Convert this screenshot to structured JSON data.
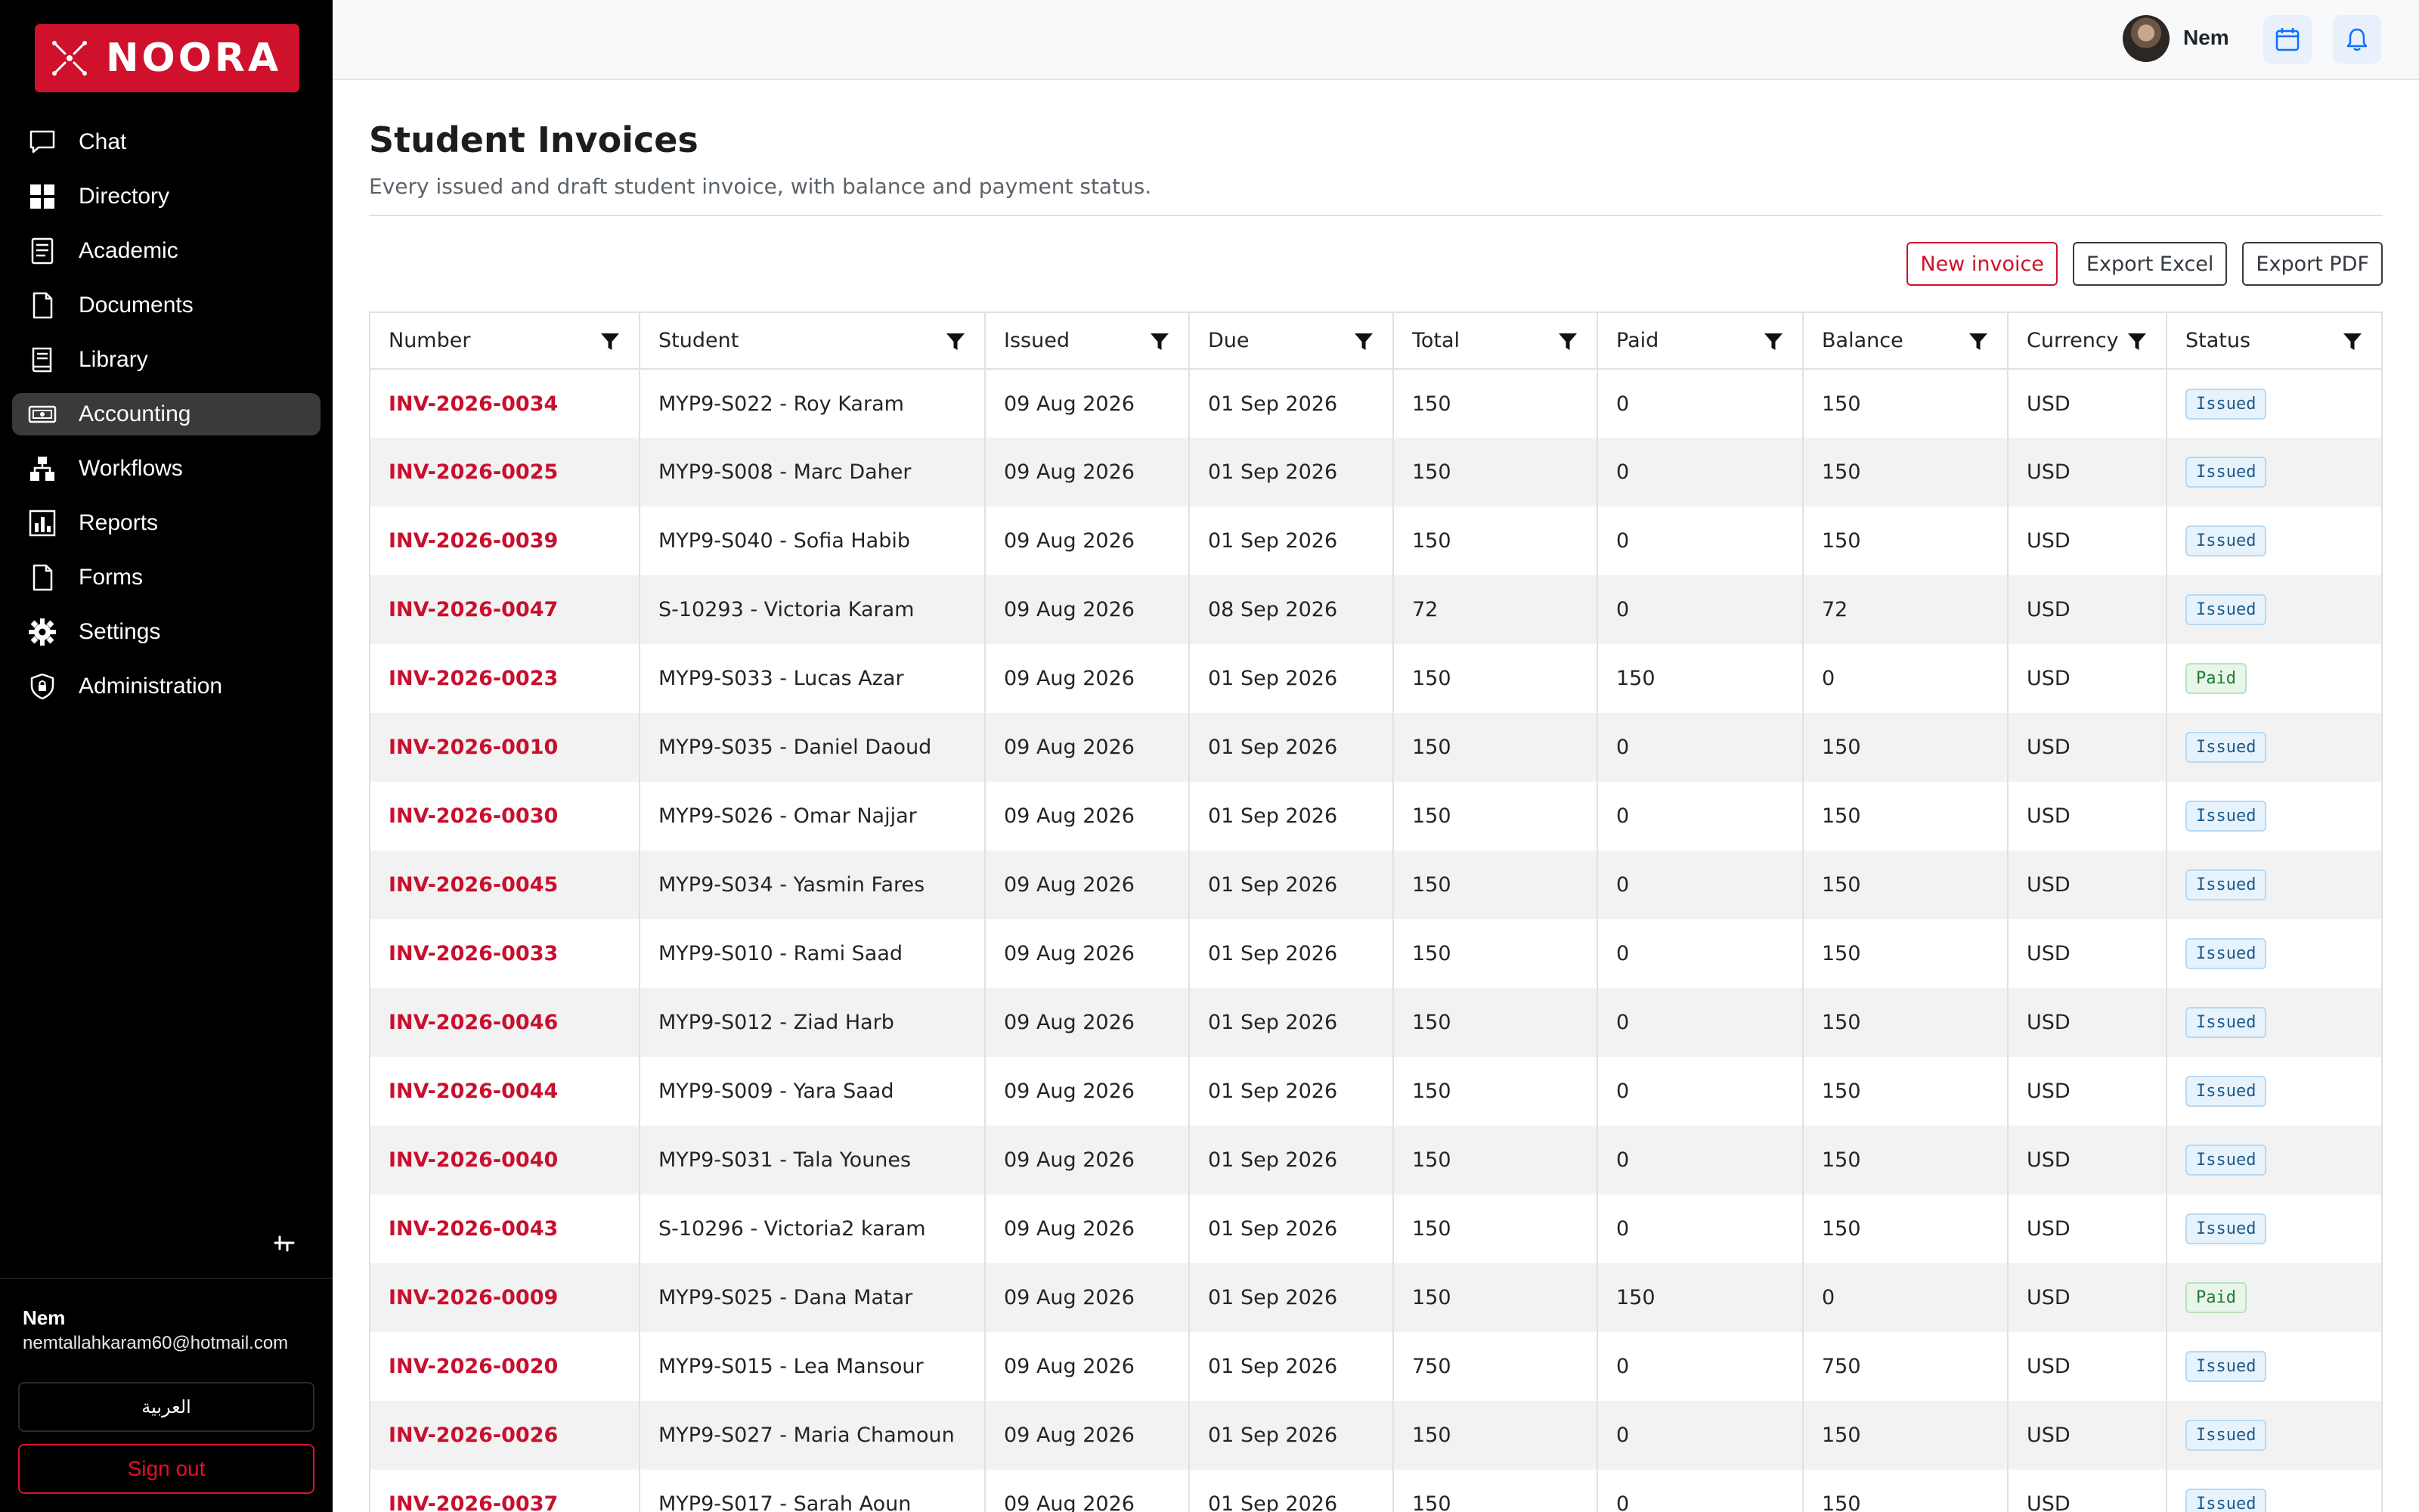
{
  "brand": {
    "name": "NOORA",
    "color": "#d0112b"
  },
  "sidebar": {
    "items": [
      {
        "label": "Chat",
        "icon": "chat-icon"
      },
      {
        "label": "Directory",
        "icon": "grid-icon"
      },
      {
        "label": "Academic",
        "icon": "notebook-icon"
      },
      {
        "label": "Documents",
        "icon": "document-icon"
      },
      {
        "label": "Library",
        "icon": "book-icon"
      },
      {
        "label": "Accounting",
        "icon": "cash-icon",
        "active": true
      },
      {
        "label": "Workflows",
        "icon": "workflow-icon"
      },
      {
        "label": "Reports",
        "icon": "chart-icon"
      },
      {
        "label": "Forms",
        "icon": "form-icon"
      },
      {
        "label": "Settings",
        "icon": "gear-icon"
      },
      {
        "label": "Administration",
        "icon": "shield-icon"
      }
    ],
    "user": {
      "name": "Nem",
      "email": "nemtallahkaram60@hotmail.com"
    },
    "language_label": "العربية",
    "signout_label": "Sign out"
  },
  "topbar": {
    "user_name": "Nem"
  },
  "page": {
    "title": "Student Invoices",
    "subtitle": "Every issued and draft student invoice, with balance and payment status."
  },
  "actions": {
    "new_invoice": "New invoice",
    "export_excel": "Export Excel",
    "export_pdf": "Export PDF"
  },
  "table": {
    "columns": [
      "Number",
      "Student",
      "Issued",
      "Due",
      "Total",
      "Paid",
      "Balance",
      "Currency",
      "Status"
    ],
    "rows": [
      [
        "INV-2026-0034",
        "MYP9-S022 - Roy Karam",
        "09 Aug 2026",
        "01 Sep 2026",
        "150",
        "0",
        "150",
        "USD",
        "Issued"
      ],
      [
        "INV-2026-0025",
        "MYP9-S008 - Marc Daher",
        "09 Aug 2026",
        "01 Sep 2026",
        "150",
        "0",
        "150",
        "USD",
        "Issued"
      ],
      [
        "INV-2026-0039",
        "MYP9-S040 - Sofia Habib",
        "09 Aug 2026",
        "01 Sep 2026",
        "150",
        "0",
        "150",
        "USD",
        "Issued"
      ],
      [
        "INV-2026-0047",
        "S-10293 - Victoria Karam",
        "09 Aug 2026",
        "08 Sep 2026",
        "72",
        "0",
        "72",
        "USD",
        "Issued"
      ],
      [
        "INV-2026-0023",
        "MYP9-S033 - Lucas Azar",
        "09 Aug 2026",
        "01 Sep 2026",
        "150",
        "150",
        "0",
        "USD",
        "Paid"
      ],
      [
        "INV-2026-0010",
        "MYP9-S035 - Daniel Daoud",
        "09 Aug 2026",
        "01 Sep 2026",
        "150",
        "0",
        "150",
        "USD",
        "Issued"
      ],
      [
        "INV-2026-0030",
        "MYP9-S026 - Omar Najjar",
        "09 Aug 2026",
        "01 Sep 2026",
        "150",
        "0",
        "150",
        "USD",
        "Issued"
      ],
      [
        "INV-2026-0045",
        "MYP9-S034 - Yasmin Fares",
        "09 Aug 2026",
        "01 Sep 2026",
        "150",
        "0",
        "150",
        "USD",
        "Issued"
      ],
      [
        "INV-2026-0033",
        "MYP9-S010 - Rami Saad",
        "09 Aug 2026",
        "01 Sep 2026",
        "150",
        "0",
        "150",
        "USD",
        "Issued"
      ],
      [
        "INV-2026-0046",
        "MYP9-S012 - Ziad Harb",
        "09 Aug 2026",
        "01 Sep 2026",
        "150",
        "0",
        "150",
        "USD",
        "Issued"
      ],
      [
        "INV-2026-0044",
        "MYP9-S009 - Yara Saad",
        "09 Aug 2026",
        "01 Sep 2026",
        "150",
        "0",
        "150",
        "USD",
        "Issued"
      ],
      [
        "INV-2026-0040",
        "MYP9-S031 - Tala Younes",
        "09 Aug 2026",
        "01 Sep 2026",
        "150",
        "0",
        "150",
        "USD",
        "Issued"
      ],
      [
        "INV-2026-0043",
        "S-10296 - Victoria2 karam",
        "09 Aug 2026",
        "01 Sep 2026",
        "150",
        "0",
        "150",
        "USD",
        "Issued"
      ],
      [
        "INV-2026-0009",
        "MYP9-S025 - Dana Matar",
        "09 Aug 2026",
        "01 Sep 2026",
        "150",
        "150",
        "0",
        "USD",
        "Paid"
      ],
      [
        "INV-2026-0020",
        "MYP9-S015 - Lea Mansour",
        "09 Aug 2026",
        "01 Sep 2026",
        "750",
        "0",
        "750",
        "USD",
        "Issued"
      ],
      [
        "INV-2026-0026",
        "MYP9-S027 - Maria Chamoun",
        "09 Aug 2026",
        "01 Sep 2026",
        "150",
        "0",
        "150",
        "USD",
        "Issued"
      ],
      [
        "INV-2026-0037",
        "MYP9-S017 - Sarah Aoun",
        "09 Aug 2026",
        "01 Sep 2026",
        "150",
        "0",
        "150",
        "USD",
        "Issued"
      ]
    ]
  },
  "colors": {
    "link": "#c8102e",
    "issued_badge": "#e7f3fc",
    "paid_badge": "#e8f6ea",
    "active_nav": "#3a3a3a"
  }
}
